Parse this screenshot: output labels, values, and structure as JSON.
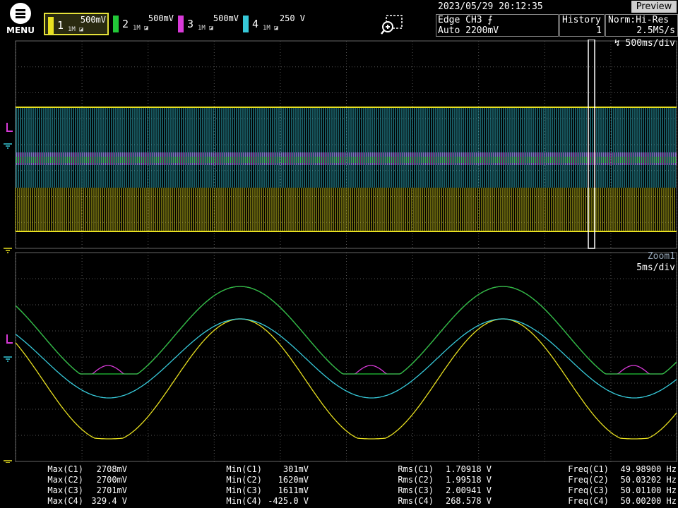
{
  "menu": {
    "label": "MENU"
  },
  "channels": [
    {
      "num": "1",
      "scale": "500mV",
      "color": "#e8e020",
      "selected": true
    },
    {
      "num": "2",
      "scale": "500mV",
      "color": "#22c838",
      "selected": false
    },
    {
      "num": "3",
      "scale": "500mV",
      "color": "#d83ad8",
      "selected": false
    },
    {
      "num": "4",
      "scale": "250 V",
      "color": "#36c8d8",
      "selected": false
    }
  ],
  "coupling_icon_text": "1M",
  "datetime": "2023/05/29 20:12:35",
  "trigger": {
    "line1": "Edge CH3",
    "line2": "Auto 2200mV"
  },
  "history": {
    "label": "History",
    "value": "1"
  },
  "acquisition": {
    "mode": "Norm:Hi-Res",
    "rate": "2.5MS/s"
  },
  "preview_label": "Preview",
  "main_timebase": "500ms/div",
  "zoom": {
    "name": "Zoom1",
    "timebase": "5ms/div"
  },
  "measurements": {
    "max": [
      {
        "label": "Max(C1)",
        "value": "2708mV"
      },
      {
        "label": "Max(C2)",
        "value": "2700mV"
      },
      {
        "label": "Max(C3)",
        "value": "2701mV"
      },
      {
        "label": "Max(C4)",
        "value": "329.4 V"
      }
    ],
    "min": [
      {
        "label": "Min(C1)",
        "value": "301mV"
      },
      {
        "label": "Min(C2)",
        "value": "1620mV"
      },
      {
        "label": "Min(C3)",
        "value": "1611mV"
      },
      {
        "label": "Min(C4)",
        "value": "-425.0 V"
      }
    ],
    "rms": [
      {
        "label": "Rms(C1)",
        "value": "1.70918 V"
      },
      {
        "label": "Rms(C2)",
        "value": "1.99518 V"
      },
      {
        "label": "Rms(C3)",
        "value": "2.00941 V"
      },
      {
        "label": "Rms(C4)",
        "value": "268.578 V"
      }
    ],
    "freq": [
      {
        "label": "Freq(C1)",
        "value": "49.98900 Hz"
      },
      {
        "label": "Freq(C2)",
        "value": "50.03202 Hz"
      },
      {
        "label": "Freq(C3)",
        "value": "50.01100 Hz"
      },
      {
        "label": "Freq(C4)",
        "value": "50.00200 Hz"
      }
    ]
  }
}
